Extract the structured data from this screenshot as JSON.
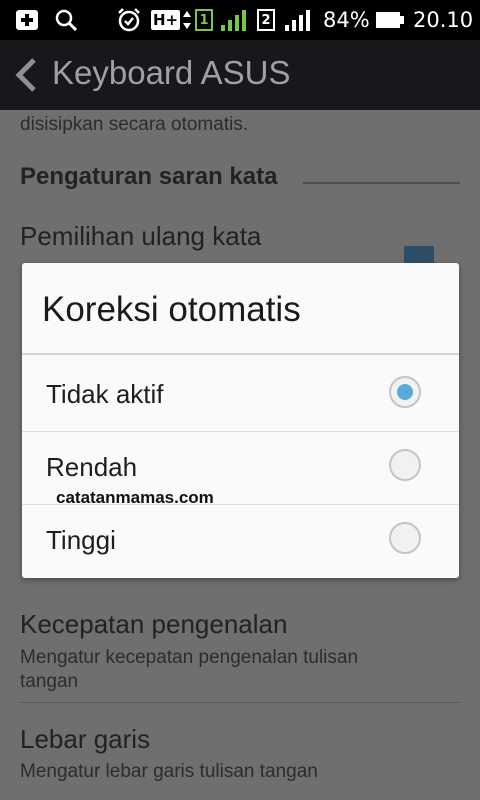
{
  "status_bar": {
    "sim1": "1",
    "sim2": "2",
    "network": "H+",
    "battery": "84%",
    "time": "20.10",
    "icons": [
      "add-notification-icon",
      "search-icon",
      "alarm-icon",
      "network-type-icon",
      "sim1-icon",
      "signal-icon",
      "sim2-icon",
      "signal-icon",
      "battery-icon"
    ]
  },
  "action_bar": {
    "title": "Keyboard ASUS"
  },
  "settings": {
    "partial_text": "disisipkan secara otomatis.",
    "section_header": "Pengaturan saran kata",
    "item1_title": "Pemilihan ulang kata",
    "item2_title": "Kecepatan pengenalan",
    "item2_sub_line1": "Mengatur kecepatan pengenalan tulisan",
    "item2_sub_line2": "tangan",
    "item3_title": "Lebar garis",
    "item3_sub": "Mengatur lebar garis tulisan tangan"
  },
  "dialog": {
    "title": "Koreksi otomatis",
    "options": [
      {
        "label": "Tidak aktif",
        "selected": true
      },
      {
        "label": "Rendah",
        "selected": false
      },
      {
        "label": "Tinggi",
        "selected": false
      }
    ],
    "watermark": "catatanmamas.com"
  },
  "colors": {
    "accent": "#5aa7dc",
    "dim_background": "#6f6f6f",
    "action_bar": "#16181b"
  }
}
